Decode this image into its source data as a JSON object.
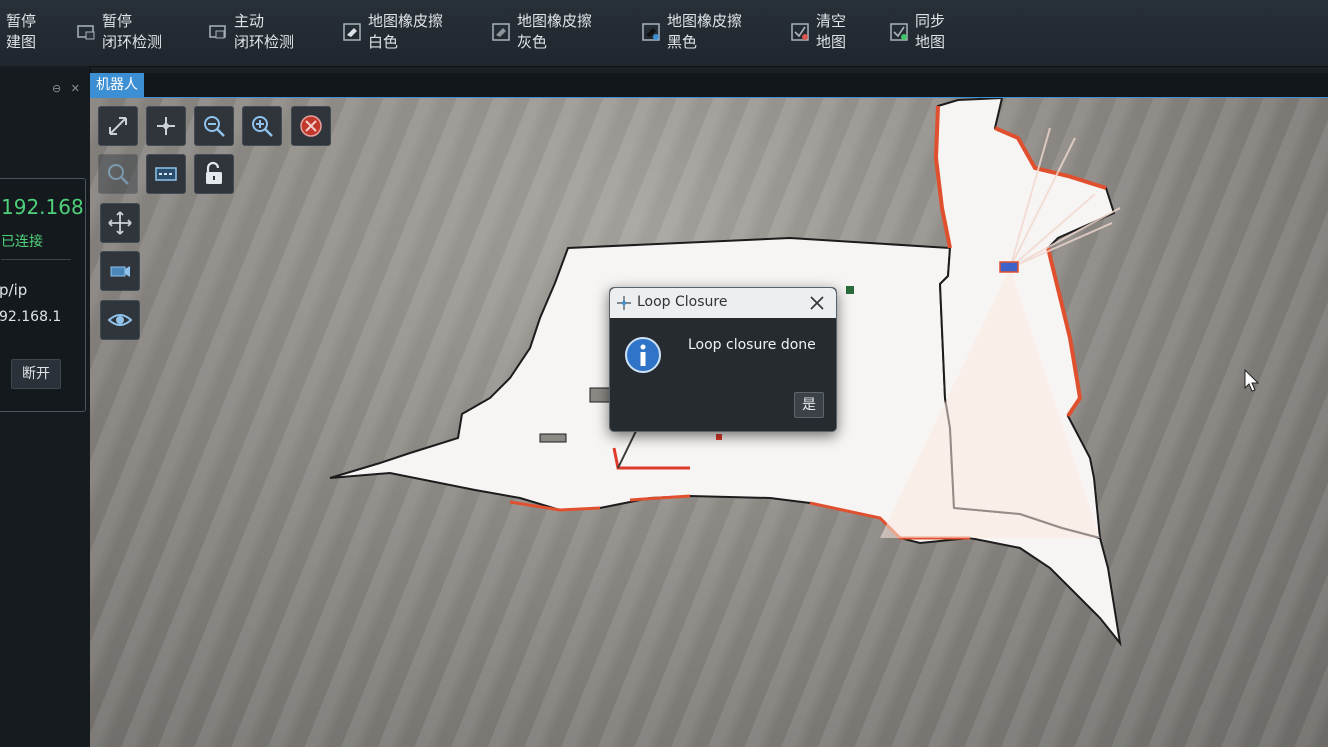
{
  "toolbar": {
    "items": [
      {
        "line1": "暂停",
        "line2": "建图",
        "icon": "pause-mapping-icon"
      },
      {
        "line1": "暂停",
        "line2": "闭环检测",
        "icon": "pause-loop-icon"
      },
      {
        "line1": "主动",
        "line2": "闭环检测",
        "icon": "active-loop-icon"
      },
      {
        "line1": "地图橡皮擦",
        "line2": "白色",
        "icon": "eraser-white-icon"
      },
      {
        "line1": "地图橡皮擦",
        "line2": "灰色",
        "icon": "eraser-gray-icon"
      },
      {
        "line1": "地图橡皮擦",
        "line2": "黑色",
        "icon": "eraser-black-icon"
      },
      {
        "line1": "清空",
        "line2": "地图",
        "icon": "clear-map-icon"
      },
      {
        "line1": "同步",
        "line2": "地图",
        "icon": "sync-map-icon"
      }
    ]
  },
  "left_panel": {
    "controls": "⊖ ✕",
    "ip_value": "192.168",
    "status": "已连接",
    "ip_label": "p/ip",
    "ip_value2": "92.168.1",
    "disconnect": "断开"
  },
  "tab": {
    "label": "机器人"
  },
  "tools": [
    {
      "name": "fit-view-icon"
    },
    {
      "name": "center-icon"
    },
    {
      "name": "zoom-out-icon"
    },
    {
      "name": "zoom-in-icon"
    },
    {
      "name": "cancel-icon"
    },
    {
      "name": "zoom-disabled-icon"
    },
    {
      "name": "robot-layer-icon"
    },
    {
      "name": "unlock-icon"
    },
    {
      "name": "move-icon"
    },
    {
      "name": "camera-icon"
    },
    {
      "name": "eye-icon"
    }
  ],
  "dialog": {
    "title": "Loop Closure",
    "message": "Loop closure done",
    "yes_label": "是"
  },
  "colors": {
    "accent": "#3d8fd4",
    "connected": "#3fc46a",
    "map_free": "#f6f4f2",
    "map_wall": "#e0502e"
  }
}
